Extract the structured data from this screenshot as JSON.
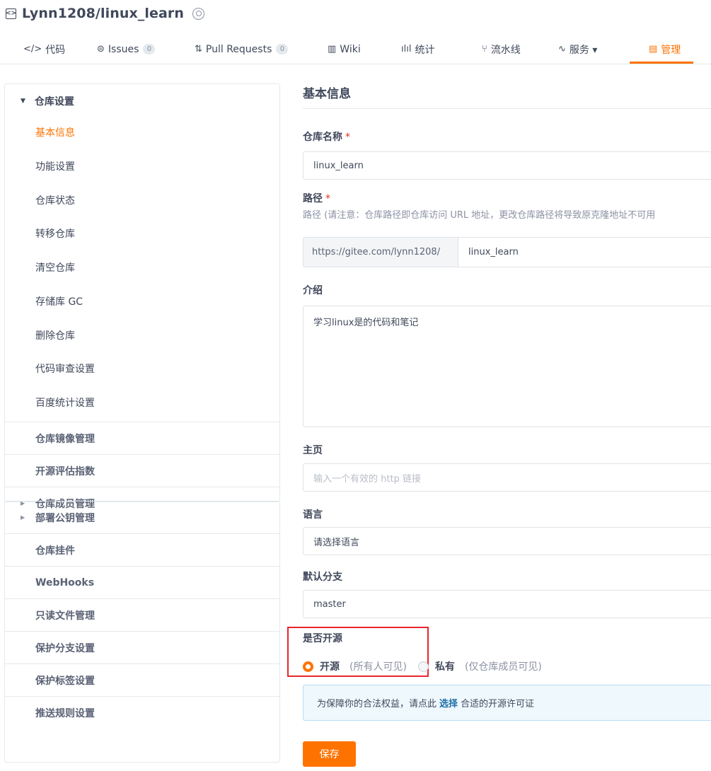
{
  "header": {
    "repo_icon": "repo-icon",
    "repo_name": "Lynn1208/linux_learn",
    "badge_icon": "badge-icon"
  },
  "tabs": [
    {
      "icon": "</>",
      "label": "代码"
    },
    {
      "icon": "⊜",
      "label": "Issues",
      "count": "0"
    },
    {
      "icon": "⇅",
      "label": "Pull Requests",
      "count": "0"
    },
    {
      "icon": "▥",
      "label": "Wiki"
    },
    {
      "icon": "ılıl",
      "label": "统计"
    },
    {
      "icon": "⑂",
      "label": "流水线"
    },
    {
      "icon": "∿",
      "label": "服务 ▾"
    },
    {
      "icon": "▤",
      "label": "管理"
    }
  ],
  "sidebar": {
    "group_title": "仓库设置",
    "sub_items": [
      "基本信息",
      "功能设置",
      "仓库状态",
      "转移仓库",
      "清空仓库",
      "存储库 GC",
      "删除仓库",
      "代码审查设置",
      "百度统计设置"
    ],
    "items": [
      "仓库镜像管理",
      "开源评估指数",
      "仓库成员管理",
      "部署公钥管理",
      "仓库挂件",
      "WebHooks",
      "只读文件管理",
      "保护分支设置",
      "保护标签设置",
      "推送规则设置"
    ]
  },
  "main": {
    "section_title": "基本信息",
    "repo_name_label": "仓库名称",
    "repo_name_value": "linux_learn",
    "path_label": "路径",
    "path_help": "路径 (请注意：仓库路径即仓库访问 URL 地址，更改仓库路径将导致原克隆地址不可用",
    "path_prefix": "https://gitee.com/lynn1208/",
    "path_value": "linux_learn",
    "intro_label": "介绍",
    "intro_value": "学习linux是的代码和笔记",
    "homepage_label": "主页",
    "homepage_placeholder": "输入一个有效的 http 链接",
    "language_label": "语言",
    "language_value": "请选择语言",
    "branch_label": "默认分支",
    "branch_value": "master",
    "open_label": "是否开源",
    "open_option": "开源",
    "open_hint": "(所有人可见)",
    "private_option": "私有",
    "private_hint": "(仅仓库成员可见)",
    "notice_prefix": "为保障你的合法权益，请点此",
    "notice_link": "选择",
    "notice_suffix": "合适的开源许可证",
    "save_label": "保存"
  },
  "colors": {
    "accent": "#fe7300",
    "highlight": "#e8252d",
    "link": "#1d6fa5"
  }
}
